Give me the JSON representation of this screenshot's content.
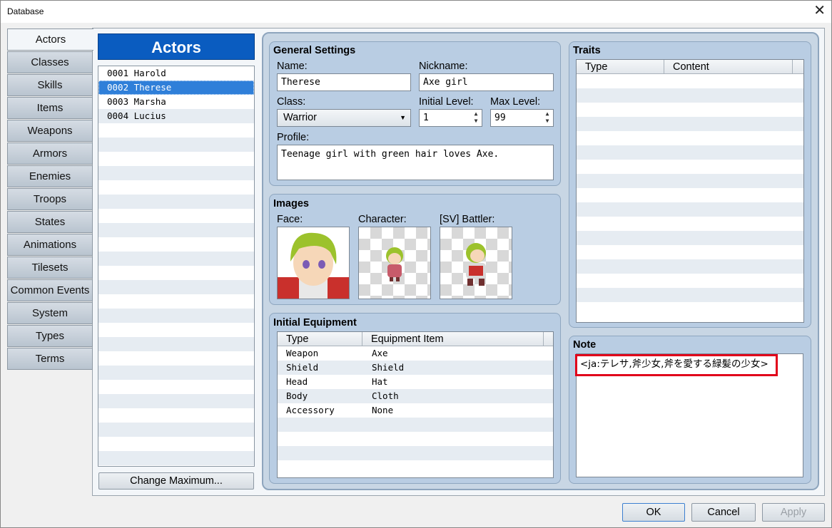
{
  "window": {
    "title": "Database",
    "close_glyph": "✕"
  },
  "tabs": [
    "Actors",
    "Classes",
    "Skills",
    "Items",
    "Weapons",
    "Armors",
    "Enemies",
    "Troops",
    "States",
    "Animations",
    "Tilesets",
    "Common Events",
    "System",
    "Types",
    "Terms"
  ],
  "active_tab": "Actors",
  "list": {
    "header": "Actors",
    "items": [
      "0001 Harold",
      "0002 Therese",
      "0003 Marsha",
      "0004 Lucius"
    ],
    "selected": "0002 Therese",
    "change_max_label": "Change Maximum..."
  },
  "general": {
    "title": "General Settings",
    "name_label": "Name:",
    "name_value": "Therese",
    "nickname_label": "Nickname:",
    "nickname_value": "Axe girl",
    "class_label": "Class:",
    "class_value": "Warrior",
    "initial_level_label": "Initial Level:",
    "initial_level_value": "1",
    "max_level_label": "Max Level:",
    "max_level_value": "99",
    "profile_label": "Profile:",
    "profile_value": "Teenage girl with green hair loves Axe."
  },
  "images": {
    "title": "Images",
    "face_label": "Face:",
    "character_label": "Character:",
    "battler_label": "[SV] Battler:"
  },
  "equipment": {
    "title": "Initial Equipment",
    "col_type": "Type",
    "col_item": "Equipment Item",
    "rows": [
      {
        "type": "Weapon",
        "item": "Axe"
      },
      {
        "type": "Shield",
        "item": "Shield"
      },
      {
        "type": "Head",
        "item": "Hat"
      },
      {
        "type": "Body",
        "item": "Cloth"
      },
      {
        "type": "Accessory",
        "item": "None"
      }
    ]
  },
  "traits": {
    "title": "Traits",
    "col_type": "Type",
    "col_content": "Content"
  },
  "note": {
    "title": "Note",
    "value": "<ja:テレサ,斧少女,斧を愛する緑髪の少女>"
  },
  "buttons": {
    "ok": "OK",
    "cancel": "Cancel",
    "apply": "Apply"
  },
  "colors": {
    "accent": "#0a5cc0",
    "selection": "#2f7fd9",
    "highlight": "#e1001a"
  }
}
